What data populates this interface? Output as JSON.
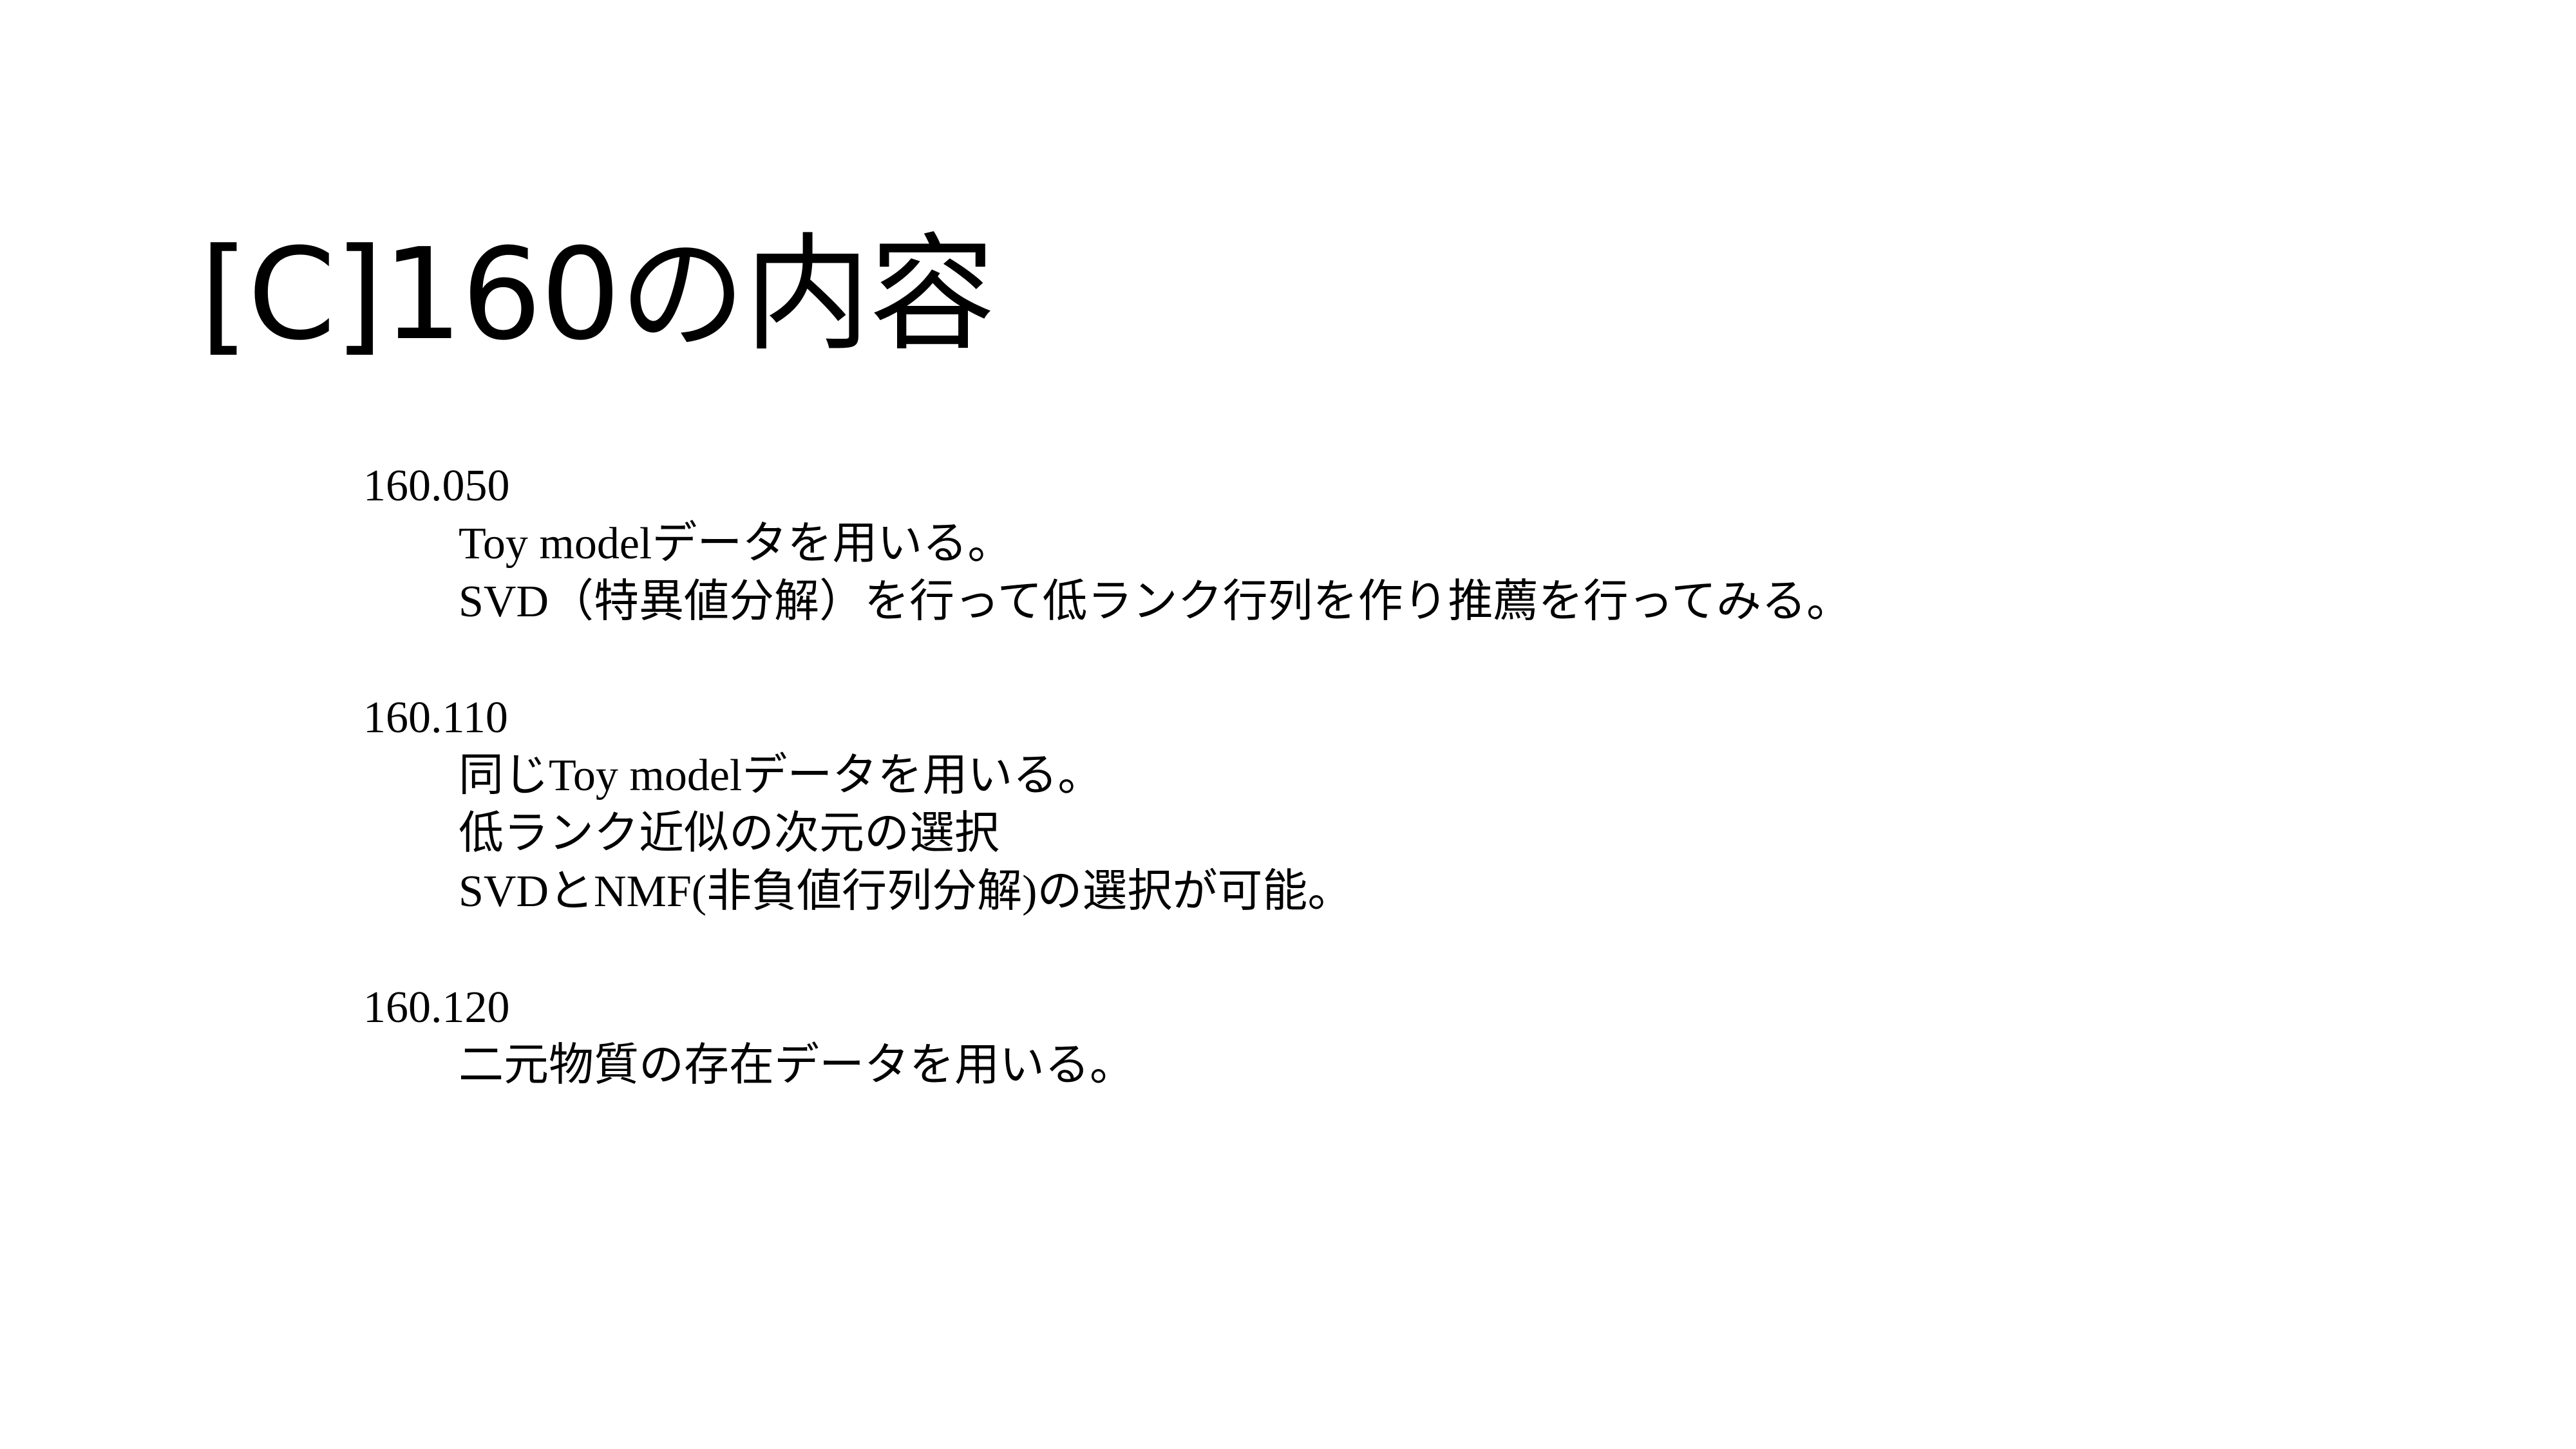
{
  "slide": {
    "title": "[C]160の内容",
    "sections": [
      {
        "id": "160.050",
        "lines": [
          "Toy modelデータを用いる。",
          "SVD（特異値分解）を行って低ランク行列を作り推薦を行ってみる。"
        ]
      },
      {
        "id": "160.110",
        "lines": [
          "同じToy modelデータを用いる。",
          "低ランク近似の次元の選択",
          "SVDとNMF(非負値行列分解)の選択が可能。"
        ]
      },
      {
        "id": "160.120",
        "lines": [
          "二元物質の存在データを用いる。"
        ]
      }
    ]
  }
}
